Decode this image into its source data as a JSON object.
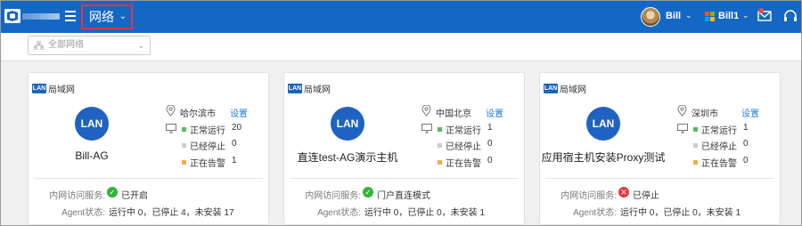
{
  "header": {
    "section_label": "网络",
    "user_name": "Bill",
    "tenant_name": "Bill1"
  },
  "filter": {
    "network_select_placeholder": "全部网络"
  },
  "cards": [
    {
      "type_label": "局域网",
      "badge_text": "LAN",
      "icon_text": "LAN",
      "name": "Bill-AG",
      "location": "哈尔滨市",
      "settings_label": "设置",
      "running_label": "正常运行",
      "running": "20",
      "stopped_label": "已经停止",
      "stopped": "0",
      "alarm_label": "正在告警",
      "alarm": "1",
      "service_label": "内网访问服务:",
      "service_status": "已开启",
      "service_state": "ok",
      "agent_label": "Agent状态:",
      "agent_status": "运行中 0，已停止 4，未安装 17"
    },
    {
      "type_label": "局域网",
      "badge_text": "LAN",
      "icon_text": "LAN",
      "name": "直连test-AG演示主机",
      "location": "中国北京",
      "settings_label": "设置",
      "running_label": "正常运行",
      "running": "1",
      "stopped_label": "已经停止",
      "stopped": "0",
      "alarm_label": "正在告警",
      "alarm": "0",
      "service_label": "内网访问服务:",
      "service_status": "门户直连模式",
      "service_state": "ok",
      "agent_label": "Agent状态:",
      "agent_status": "运行中 0，已停止 0，未安装 1"
    },
    {
      "type_label": "局域网",
      "badge_text": "LAN",
      "icon_text": "LAN",
      "name": "应用宿主机安装Proxy测试",
      "location": "深圳市",
      "settings_label": "设置",
      "running_label": "正常运行",
      "running": "1",
      "stopped_label": "已经停止",
      "stopped": "0",
      "alarm_label": "正在告警",
      "alarm": "0",
      "service_label": "内网访问服务:",
      "service_status": "已停止",
      "service_state": "stopped",
      "agent_label": "Agent状态:",
      "agent_status": "运行中 0，已停止 0，未安装 1"
    }
  ],
  "colors": {
    "header_bg": "#1467c4",
    "running": "#5cb85c",
    "stopped": "#cccccc",
    "alarm": "#f0ad4e",
    "ok_icon": "#32b33c",
    "stopped_icon": "#e8383d",
    "link": "#1a7fd4"
  }
}
